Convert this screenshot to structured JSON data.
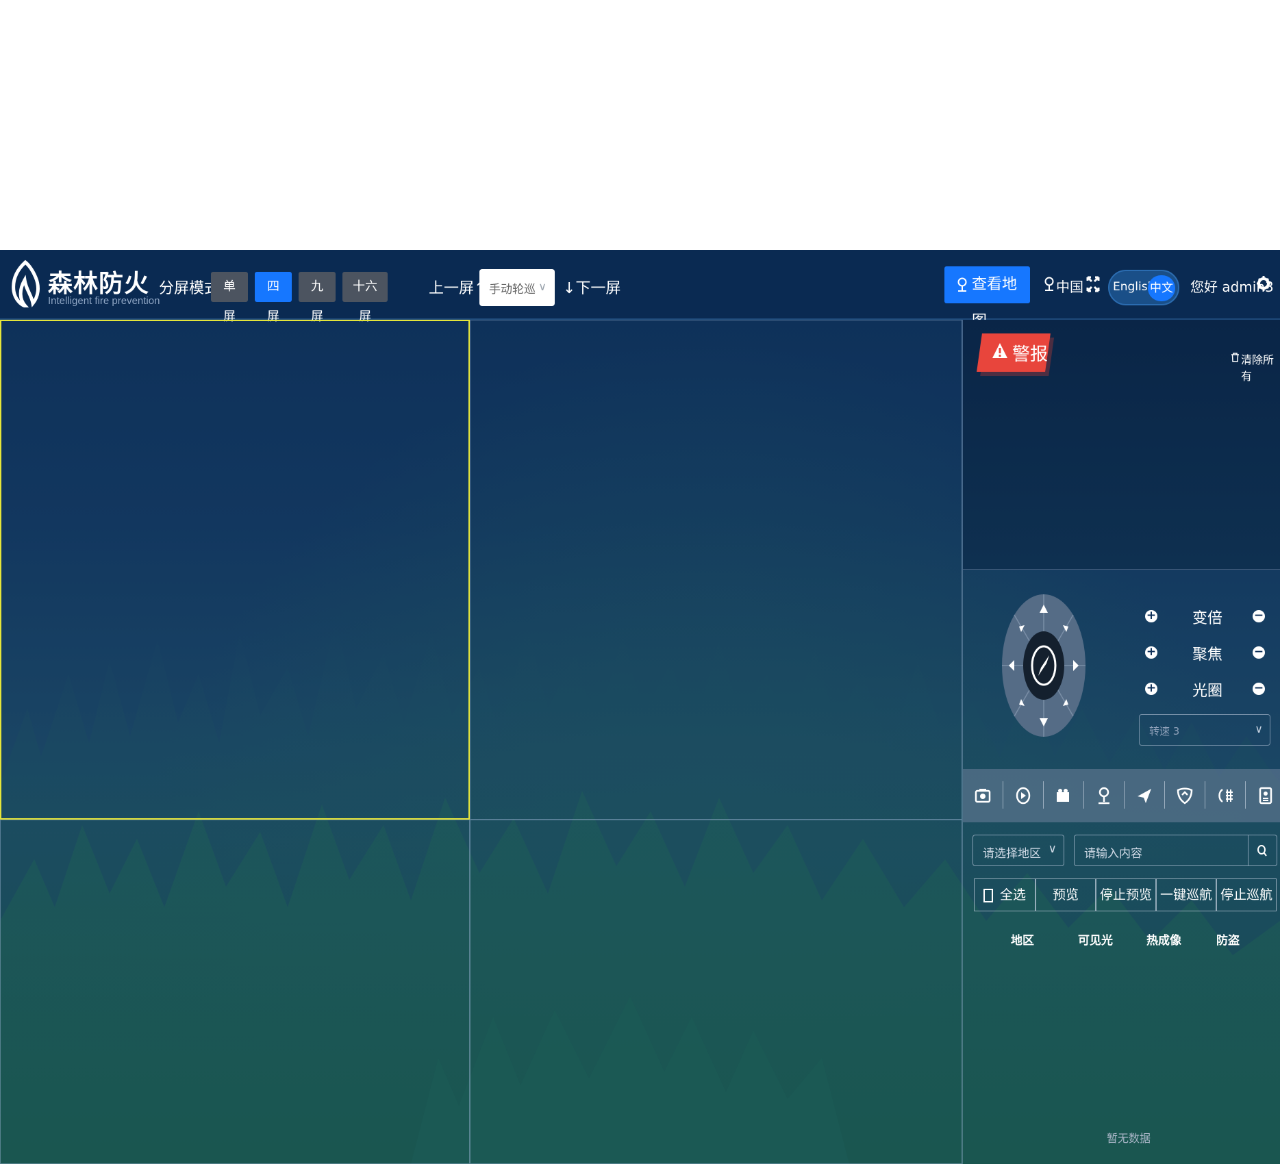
{
  "header": {
    "logo_cn": "森林防火",
    "logo_en": "Intelligent fire prevention",
    "split_label": "分屏模式",
    "split_modes": [
      {
        "label": "单屏",
        "active": false
      },
      {
        "label": "四屏",
        "active": true
      },
      {
        "label": "九屏",
        "active": false
      },
      {
        "label": "十六屏",
        "active": false
      }
    ],
    "prev_screen": "上一屏↑",
    "tour_mode": "手动轮巡",
    "next_screen": "↓下一屏",
    "map_button": "查看地图",
    "region": "中国",
    "lang_en": "English",
    "lang_cn": "中文",
    "greeting": "您好 admin3"
  },
  "alarm": {
    "title": "警报",
    "clear_all": "清除所有"
  },
  "ptz": {
    "rows": [
      {
        "label": "变倍"
      },
      {
        "label": "聚焦"
      },
      {
        "label": "光圈"
      }
    ],
    "speed_placeholder": "转速 3"
  },
  "tools": [
    "camera-icon",
    "play-circle-icon",
    "video-camera-icon",
    "user-pin-icon",
    "send-icon",
    "shield-icon",
    "light-icon",
    "doc-icon"
  ],
  "filter": {
    "region_placeholder": "请选择地区",
    "search_placeholder": "请输入内容"
  },
  "actions": {
    "select_all": "全选",
    "preview": "预览",
    "stop_preview": "停止预览",
    "one_key_cruise": "一键巡航",
    "stop_cruise": "停止巡航"
  },
  "table": {
    "columns": [
      "地区",
      "可见光",
      "热成像",
      "防盗"
    ],
    "empty": "暂无数据"
  }
}
